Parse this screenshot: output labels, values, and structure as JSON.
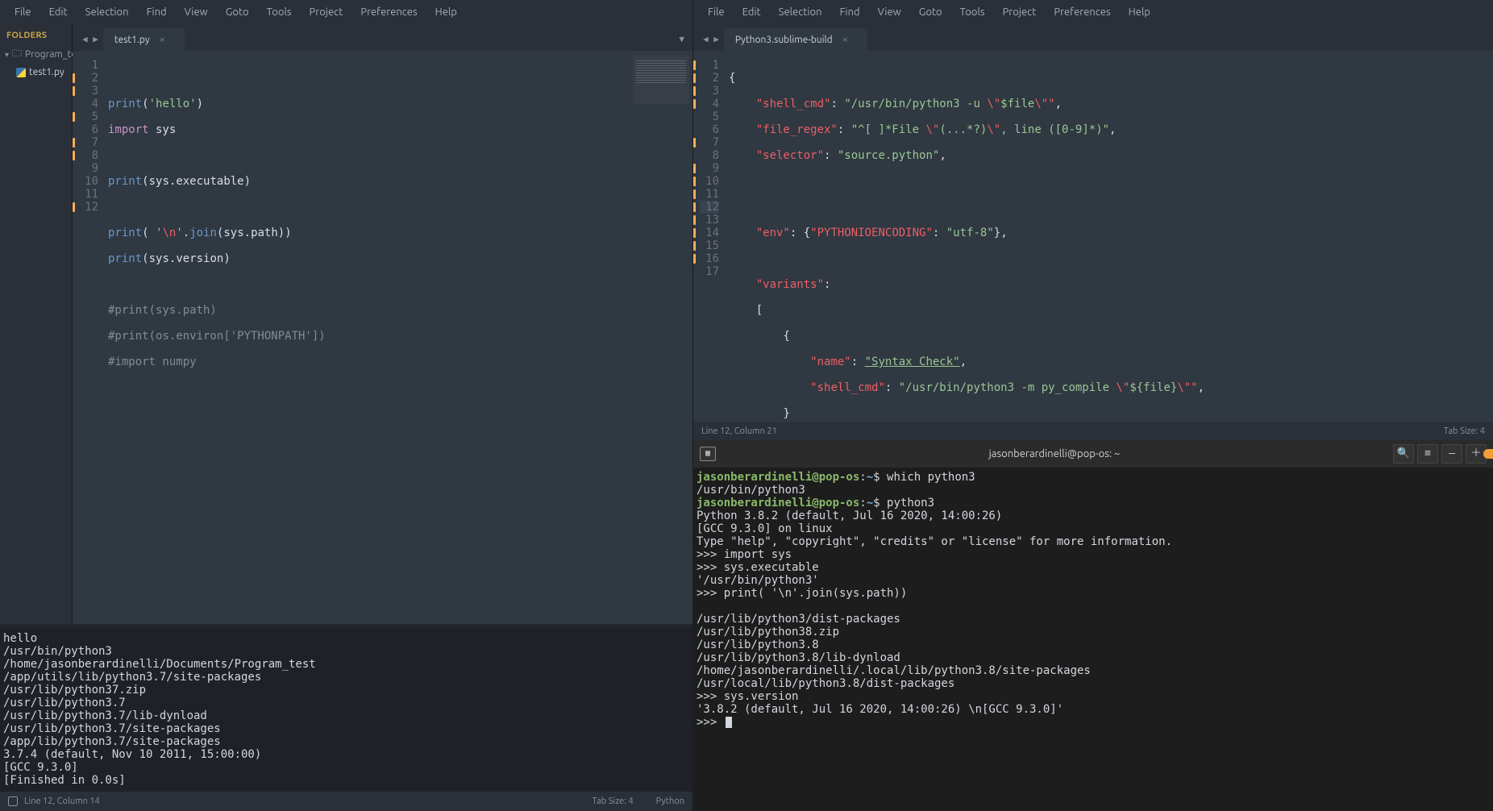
{
  "left": {
    "menu": [
      "File",
      "Edit",
      "Selection",
      "Find",
      "View",
      "Goto",
      "Tools",
      "Project",
      "Preferences",
      "Help"
    ],
    "sidebar": {
      "title": "FOLDERS",
      "folder": "Program_tes",
      "file": "test1.py"
    },
    "tab": "test1.py",
    "lines": [
      "1",
      "2",
      "3",
      "4",
      "5",
      "6",
      "7",
      "8",
      "9",
      "10",
      "11",
      "12"
    ],
    "code": {
      "l2a": "print",
      "l2b": "(",
      "l2c": "'hello'",
      "l2d": ")",
      "l3a": "import",
      "l3b": " sys",
      "l5a": "print",
      "l5b": "(sys",
      "l5c": ".",
      "l5d": "executable)",
      "l7a": "print",
      "l7b": "( ",
      "l7c": "'",
      "l7d": "\\n",
      "l7e": "'",
      "l7f": ".",
      "l7g": "join",
      "l7h": "(sys",
      "l7i": ".",
      "l7j": "path))",
      "l8a": "print",
      "l8b": "(sys",
      "l8c": ".",
      "l8d": "version)",
      "l10": "#print(sys.path)",
      "l11": "#print(os.environ['PYTHONPATH'])",
      "l12": "#import numpy"
    },
    "console": "hello\n/usr/bin/python3\n/home/jasonberardinelli/Documents/Program_test\n/app/utils/lib/python3.7/site-packages\n/usr/lib/python37.zip\n/usr/lib/python3.7\n/usr/lib/python3.7/lib-dynload\n/usr/lib/python3.7/site-packages\n/app/lib/python3.7/site-packages\n3.7.4 (default, Nov 10 2011, 15:00:00)\n[GCC 9.3.0]\n[Finished in 0.0s]",
    "status": {
      "pos": "Line 12, Column 14",
      "tab": "Tab Size: 4",
      "lang": "Python"
    }
  },
  "right": {
    "menu": [
      "File",
      "Edit",
      "Selection",
      "Find",
      "View",
      "Goto",
      "Tools",
      "Project",
      "Preferences",
      "Help"
    ],
    "tab": "Python3.sublime-build",
    "lines": [
      "1",
      "2",
      "3",
      "4",
      "5",
      "6",
      "7",
      "8",
      "9",
      "10",
      "11",
      "12",
      "13",
      "14",
      "15",
      "16",
      "17"
    ],
    "code": {
      "l1": "{",
      "l2k": "\"shell_cmd\"",
      "l2v": ": ",
      "l2s": "\"/usr/bin/python3 -u ",
      "l2e": "\\\"",
      "l2f": "$file",
      "l2g": "\\\"\"",
      "l2c": ",",
      "l3k": "\"file_regex\"",
      "l3v": ": ",
      "l3s": "\"^[ ]*File ",
      "l3e1": "\\\"",
      "l3m": "(...*?)",
      "l3e2": "\\\"",
      "l3t": ", line ([0-9]*)\"",
      "l3c": ",",
      "l4k": "\"selector\"",
      "l4v": ": ",
      "l4s": "\"source.python\"",
      "l4c": ",",
      "l7k": "\"env\"",
      "l7v": ": {",
      "l7k2": "\"PYTHONIOENCODING\"",
      "l7v2": ": ",
      "l7s": "\"utf-8\"",
      "l7c": "},",
      "l9k": "\"variants\"",
      "l9v": ":",
      "l10": "[",
      "l11": "{",
      "l12k": "\"name\"",
      "l12v": ": ",
      "l12s": "\"Syntax Check\"",
      "l12c": ",",
      "l13k": "\"shell_cmd\"",
      "l13v": ": ",
      "l13s": "\"/usr/bin/python3 -m py_compile ",
      "l13e1": "\\\"",
      "l13f": "${file}",
      "l13e2": "\\\"\"",
      "l13c": ",",
      "l14": "}",
      "l15": "]",
      "l16": "}"
    },
    "status": {
      "pos": "Line 12, Column 21",
      "tab": "Tab Size: 4"
    },
    "terminal": {
      "title": "jasonberardinelli@pop-os: ~",
      "prompt_user": "jasonberardinelli@pop-os",
      "prompt_path": "~",
      "cmd1": "which python3",
      "out1": "/usr/bin/python3",
      "cmd2": "python3",
      "body": "Python 3.8.2 (default, Jul 16 2020, 14:00:26)\n[GCC 9.3.0] on linux\nType \"help\", \"copyright\", \"credits\" or \"license\" for more information.\n>>> import sys\n>>> sys.executable\n'/usr/bin/python3'\n>>> print( '\\n'.join(sys.path))\n\n/usr/lib/python3/dist-packages\n/usr/lib/python38.zip\n/usr/lib/python3.8\n/usr/lib/python3.8/lib-dynload\n/home/jasonberardinelli/.local/lib/python3.8/site-packages\n/usr/local/lib/python3.8/dist-packages\n>>> sys.version\n'3.8.2 (default, Jul 16 2020, 14:00:26) \\n[GCC 9.3.0]'\n>>> "
    }
  }
}
